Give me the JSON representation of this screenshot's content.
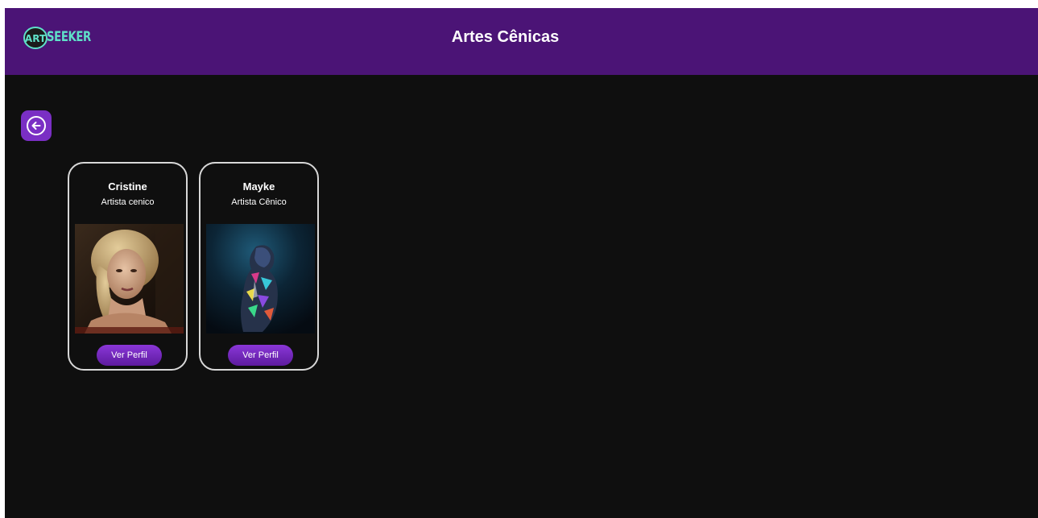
{
  "header": {
    "logo_text": "ART SEEKER",
    "logo_wordmark": "SEEKER",
    "title": "Artes Cênicas",
    "background_color": "#4b1476"
  },
  "navigation": {
    "back_icon": "arrow-left-circle-icon"
  },
  "artists": [
    {
      "name": "Cristine",
      "role": "Artista cenico",
      "button_label": "Ver Perfil"
    },
    {
      "name": "Mayke",
      "role": "Artista Cênico",
      "button_label": "Ver Perfil"
    }
  ],
  "colors": {
    "accent": "#7a2fc4",
    "background": "#0f0f0f",
    "logo": "#5fe0c8"
  }
}
